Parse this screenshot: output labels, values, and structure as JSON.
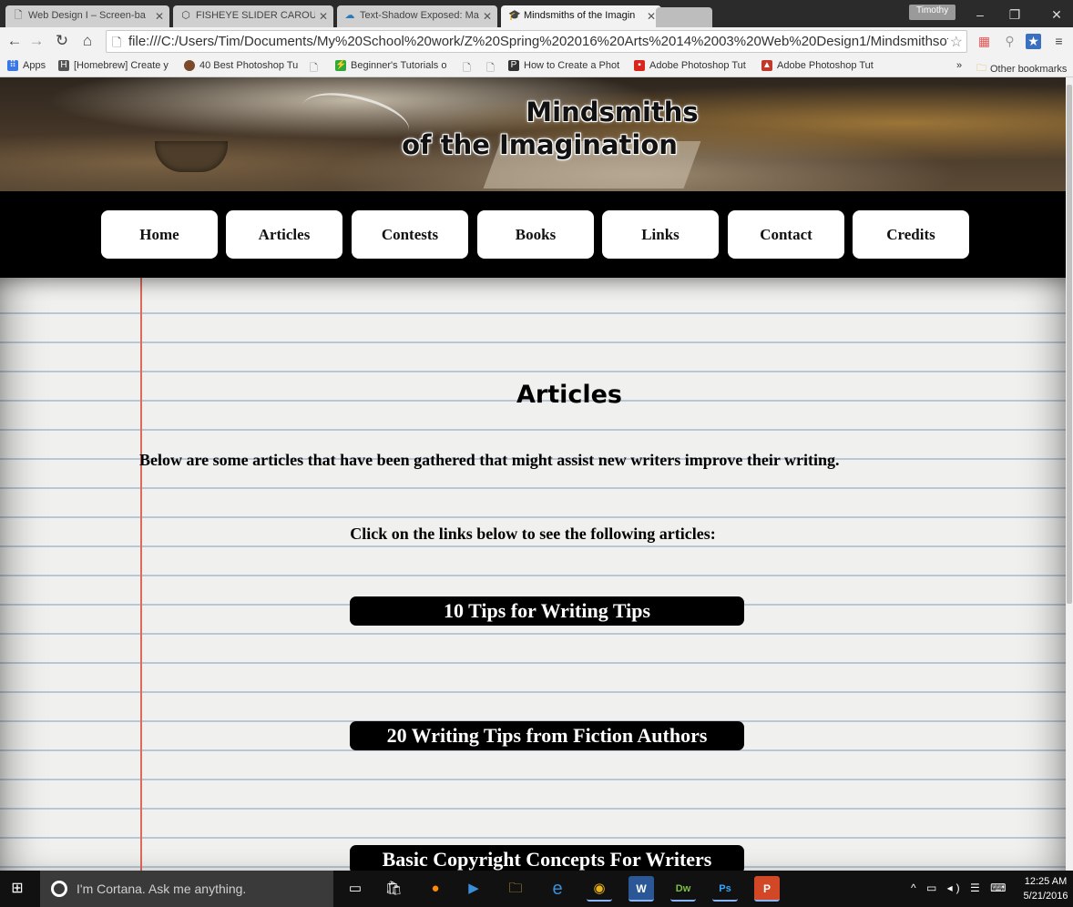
{
  "browser": {
    "tabs": [
      {
        "title": "Web Design I – Screen-ba",
        "icon": "page-icon"
      },
      {
        "title": "FISHEYE SLIDER CAROUSE",
        "icon": "codepen-icon"
      },
      {
        "title": "Text-Shadow Exposed: Ma",
        "icon": "cloud-icon"
      },
      {
        "title": "Mindsmiths of the Imagin",
        "icon": "mortarboard-icon"
      }
    ],
    "profile_name": "Timothy",
    "url": "file:///C:/Users/Tim/Documents/My%20School%20work/Z%20Spring%202016%20Arts%2014%2003%20Web%20Design1/Mindsmithsofth",
    "bookmarks": [
      {
        "label": "Apps",
        "icon": "apps-icon",
        "color": "#3b78e7"
      },
      {
        "label": "[Homebrew] Create y",
        "icon": "homebrew-icon",
        "color": "#555555"
      },
      {
        "label": "40 Best Photoshop Tu",
        "icon": "avatar-icon",
        "color": "#7a4b2a"
      },
      {
        "label": "",
        "icon": "page-icon",
        "color": "#ffffff"
      },
      {
        "label": "Beginner's Tutorials o",
        "icon": "lightning-icon",
        "color": "#2eaa3a"
      },
      {
        "label": "",
        "icon": "page-icon",
        "color": "#ffffff"
      },
      {
        "label": "",
        "icon": "page-icon",
        "color": "#ffffff"
      },
      {
        "label": "How to Create a Phot",
        "icon": "ps-icon",
        "color": "#333333"
      },
      {
        "label": "Adobe Photoshop Tut",
        "icon": "adobe-icon",
        "color": "#d9261c"
      },
      {
        "label": "Adobe Photoshop Tut",
        "icon": "hat-icon",
        "color": "#c0392b"
      }
    ],
    "overflow": "»",
    "other_bookmarks": "Other bookmarks"
  },
  "site": {
    "title_line1": "Mindsmiths",
    "title_line2": "of the Imagination",
    "nav": [
      "Home",
      "Articles",
      "Contests",
      "Books",
      "Links",
      "Contact",
      "Credits"
    ]
  },
  "content": {
    "heading": "Articles",
    "intro": "Below are some articles that have been gathered that might assist new writers improve their writing.",
    "instruction": "Click on the links below to see the following articles:",
    "articles": [
      "10 Tips for Writing Tips",
      "20 Writing Tips from Fiction Authors",
      "Basic Copyright Concepts For Writers"
    ]
  },
  "taskbar": {
    "search_placeholder": "I'm Cortana. Ask me anything.",
    "time": "12:25 AM",
    "date": "5/21/2016",
    "apps": [
      "task-view-icon",
      "store-icon",
      "firefox-icon",
      "media-icon",
      "file-explorer-icon",
      "edge-icon",
      "chrome-icon",
      "word-icon",
      "dreamweaver-icon",
      "photoshop-icon",
      "powerpoint-icon"
    ]
  },
  "colors": {
    "nav_bg": "#000000",
    "nav_button": "#ffffff",
    "article_button": "#000000",
    "margin_line": "#e06a5a",
    "ruled_line": "#b9c6d8"
  }
}
